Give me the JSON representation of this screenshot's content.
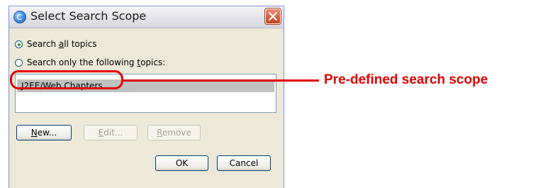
{
  "dialog": {
    "title": "Select Search Scope"
  },
  "options": {
    "search_all": {
      "label_pre": "Search ",
      "label_mn": "a",
      "label_post": "ll topics",
      "selected": true
    },
    "search_only": {
      "label_pre": "Search only the following ",
      "label_mn": "t",
      "label_post": "opics:",
      "selected": false
    }
  },
  "list": {
    "items": [
      "J2EE/Web Chapters"
    ]
  },
  "buttons": {
    "new": {
      "mn": "N",
      "rest": "ew..."
    },
    "edit": {
      "mn": "E",
      "rest": "dit..."
    },
    "remove": {
      "mn": "R",
      "rest": "emove"
    },
    "ok": "OK",
    "cancel": "Cancel"
  },
  "annotation": {
    "label": "Pre-defined search scope",
    "color": "#e00000"
  }
}
